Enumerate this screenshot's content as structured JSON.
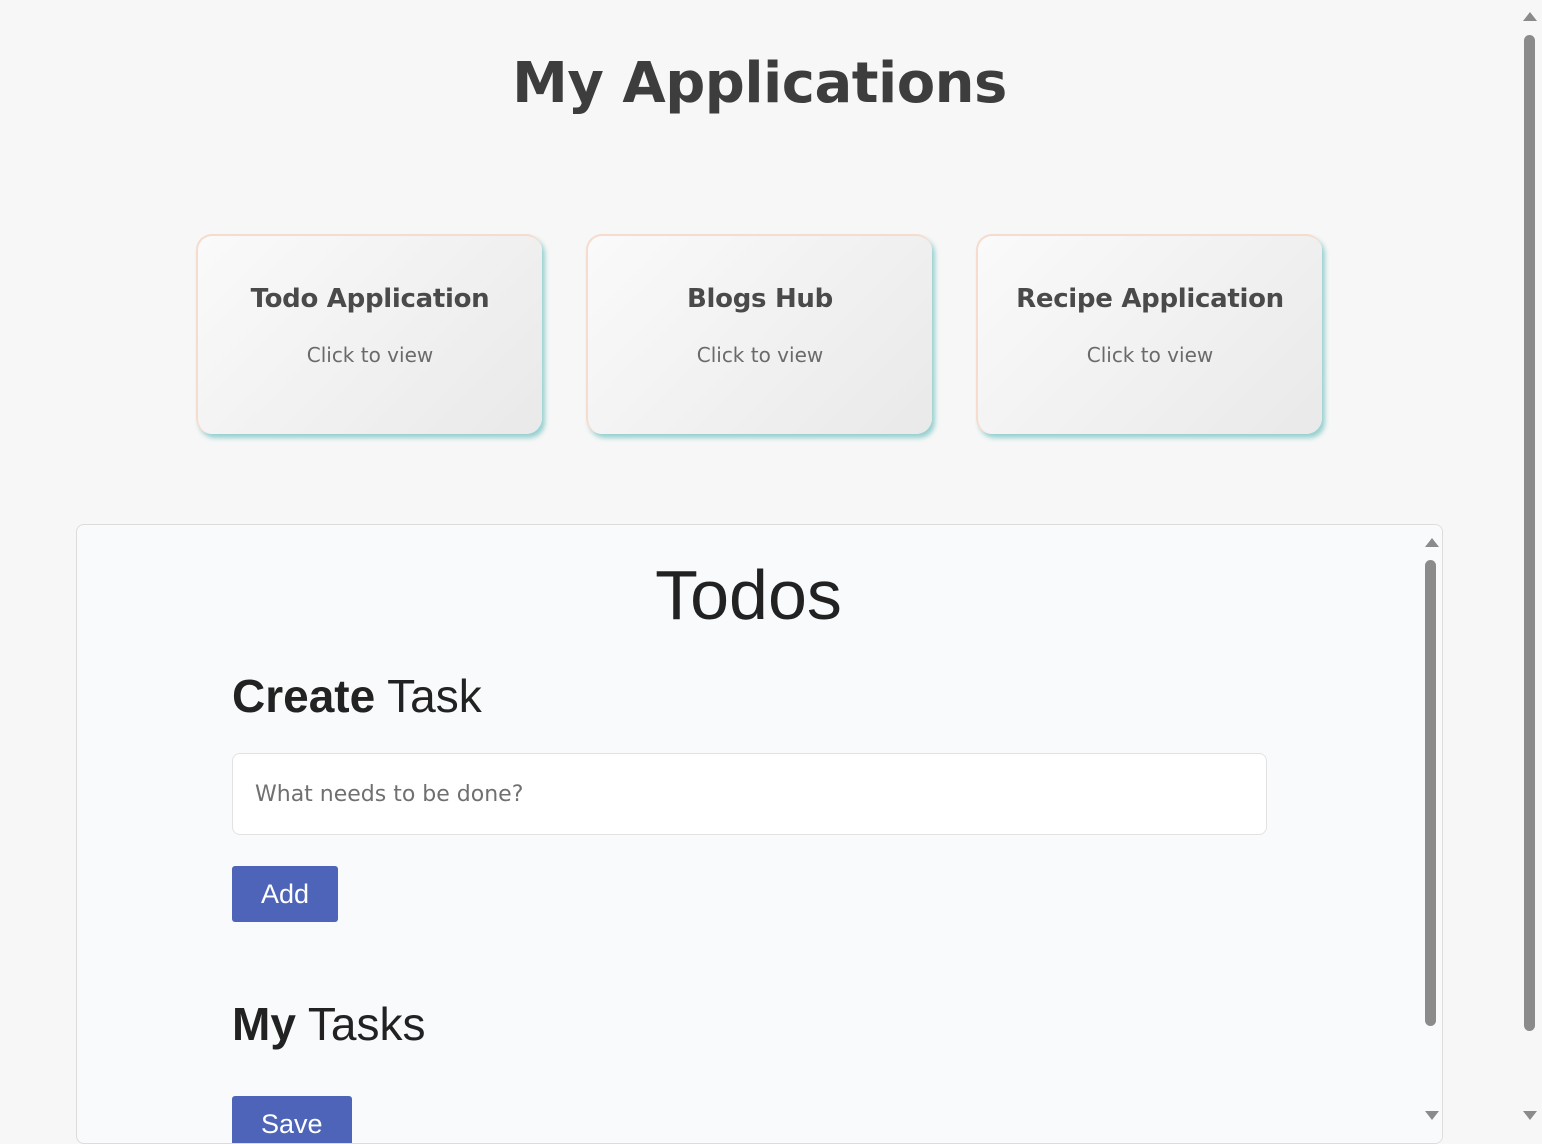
{
  "page": {
    "title": "My Applications"
  },
  "apps": [
    {
      "title": "Todo Application",
      "subtitle": "Click to view"
    },
    {
      "title": "Blogs Hub",
      "subtitle": "Click to view"
    },
    {
      "title": "Recipe Application",
      "subtitle": "Click to view"
    }
  ],
  "todos": {
    "heading": "Todos",
    "create_heading_bold": "Create",
    "create_heading_rest": " Task",
    "input_placeholder": "What needs to be done?",
    "input_value": "",
    "add_label": "Add",
    "tasks_heading_bold": "My",
    "tasks_heading_rest": " Tasks",
    "save_label": "Save"
  },
  "icons": {
    "scroll_up": "scroll-up-arrow-icon",
    "scroll_down": "scroll-down-arrow-icon"
  },
  "colors": {
    "background": "#f7f7f7",
    "primary_button": "#4d64b8",
    "card_shadow": "#78c3c3",
    "card_border": "#f6dccc"
  }
}
